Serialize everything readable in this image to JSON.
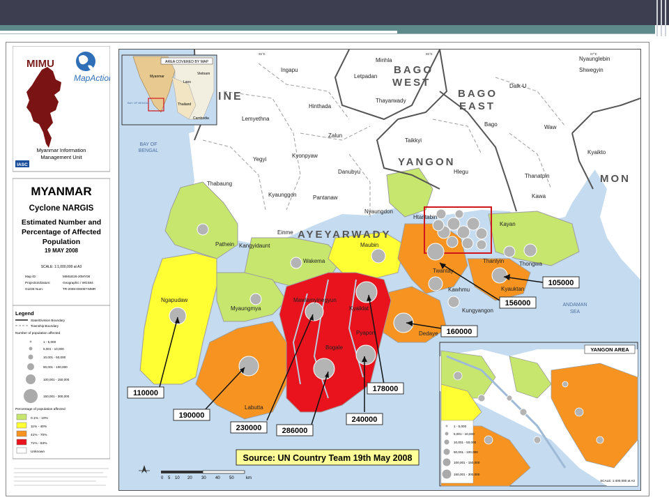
{
  "header": {
    "bg": "#3d3e50",
    "accent": "#5e8a8c"
  },
  "sidebar": {
    "org1": "MIMU",
    "org2": "MapAction",
    "org_full_1": "Myanmar Information",
    "org_full_2": "Management Unit",
    "iasc": "IASC",
    "country": "MYANMAR",
    "event": "Cyclone NARGIS",
    "subtitle_1": "Estimated Number and",
    "subtitle_2": "Percentage of Affected",
    "subtitle_3": "Population",
    "date": "19 MAY 2008",
    "scale": "SCALE: 1:1,000,000 at A3",
    "meta_keys": [
      "Map ID:",
      "Projection/Datum:",
      "GLIDE Num:"
    ],
    "meta_vals": [
      "MIMUE26-20MY08",
      "Geographic / WGS84",
      "TR-2008-000057-MMR"
    ],
    "legend_title": "Legend",
    "legend_state": "State/Division Boundary",
    "legend_township": "Township Boundary",
    "legend_num_title": "Number of population affected",
    "legend_sizes": [
      "1 - 5,000",
      "5,001 - 10,000",
      "10,001 - 50,000",
      "50,001 - 100,000",
      "100,001 - 150,000",
      "150,001 - 300,000"
    ],
    "legend_pct_title": "Percentage of population affected",
    "legend_pct": [
      {
        "label": "0.1% - 10%",
        "color": "#c6e66e"
      },
      {
        "label": "11% - 40%",
        "color": "#ffff33"
      },
      {
        "label": "41% - 70%",
        "color": "#f79421"
      },
      {
        "label": "71% - 84%",
        "color": "#e8131c"
      },
      {
        "label": "Unknown",
        "color": "#ffffff"
      }
    ]
  },
  "map": {
    "source": "Source: UN Country Team 19th May 2008",
    "sea_color": "#c5dbf0",
    "division_labels": [
      "BAGO",
      "WEST",
      "BAGO",
      "EAST",
      "YANGON",
      "AYEYARWADY",
      "MON"
    ],
    "sea_labels": [
      "BAY OF",
      "BENGAL",
      "ANDAMAN",
      "SEA"
    ],
    "partial_label": "INE",
    "townships": [
      "Minhla",
      "Letpadan",
      "Ingapu",
      "Nyaunglebin",
      "Shwegyin",
      "Daik-U",
      "Lemyethna",
      "Hinthada",
      "Thayarwady",
      "Bago",
      "Waw",
      "Zalun",
      "Taikkyi",
      "Kyaikto",
      "Yegyi",
      "Kyonpyaw",
      "Danubyu",
      "Hlegu",
      "Thanatpin",
      "Kawa",
      "Thabaung",
      "Kyaunggon",
      "Pantanaw",
      "Nyaungdon",
      "Htantabin",
      "Kayan",
      "Pathein",
      "Kangyidaunt",
      "Einme",
      "Maubin",
      "Thanlyin",
      "Thongwa",
      "Wakema",
      "Twantay",
      "Kyauktan",
      "Kawhmu",
      "Kungyangon",
      "Ngapudaw",
      "Mawlamyinegyun",
      "Kyaiklat",
      "Myaungmya",
      "Dedaye",
      "Pyapon",
      "Bogale",
      "Labutta"
    ],
    "callouts": [
      "105000",
      "156000",
      "160000",
      "110000",
      "190000",
      "230000",
      "286000",
      "240000",
      "178000"
    ],
    "inset_title": "AREA COVERED BY MAP",
    "inset_labels": [
      "Myanmar",
      "Laos",
      "Vietnam",
      "Thailand",
      "Cambodia",
      "BAY OF BENGAL"
    ],
    "yangon_area_title": "YANGON AREA",
    "yangon_legend": [
      "1 - 5,000",
      "5,001 - 10,000",
      "10,001 - 50,000",
      "50,001 - 100,000",
      "100,001 - 150,000",
      "150,001 - 300,000"
    ],
    "yangon_scale": "SCALE: 1:400,000 at A3",
    "scale_ticks": [
      "0",
      "5",
      "10",
      "20",
      "30",
      "40",
      "50"
    ],
    "scale_unit": "km",
    "lon_ticks": [
      "95°E",
      "96°E",
      "97°E"
    ]
  }
}
